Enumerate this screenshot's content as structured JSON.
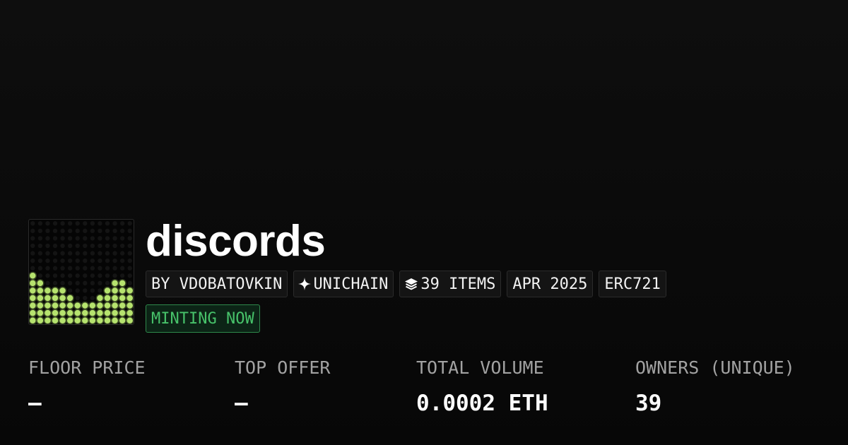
{
  "collection": {
    "name": "discords",
    "thumbnail_icon": "collection-thumbnail-pixel-art"
  },
  "tags": [
    {
      "label": "BY VDOBATOVKIN",
      "icon": ""
    },
    {
      "label": "UNICHAIN",
      "icon": "sparkle-icon"
    },
    {
      "label": "39 ITEMS",
      "icon": "layers-icon"
    },
    {
      "label": "APR 2025",
      "icon": ""
    },
    {
      "label": "ERC721",
      "icon": ""
    }
  ],
  "status": {
    "label": "MINTING NOW",
    "color": "#47c26a"
  },
  "stats": [
    {
      "label": "FLOOR PRICE",
      "value": "–"
    },
    {
      "label": "TOP OFFER",
      "value": "–"
    },
    {
      "label": "TOTAL VOLUME",
      "value": "0.0002 ETH"
    },
    {
      "label": "OWNERS (UNIQUE)",
      "value": "39"
    }
  ],
  "colors": {
    "background": "#0b0b0b",
    "accent_green": "#47c26a",
    "thumbnail_dots": "#b6e36e"
  }
}
